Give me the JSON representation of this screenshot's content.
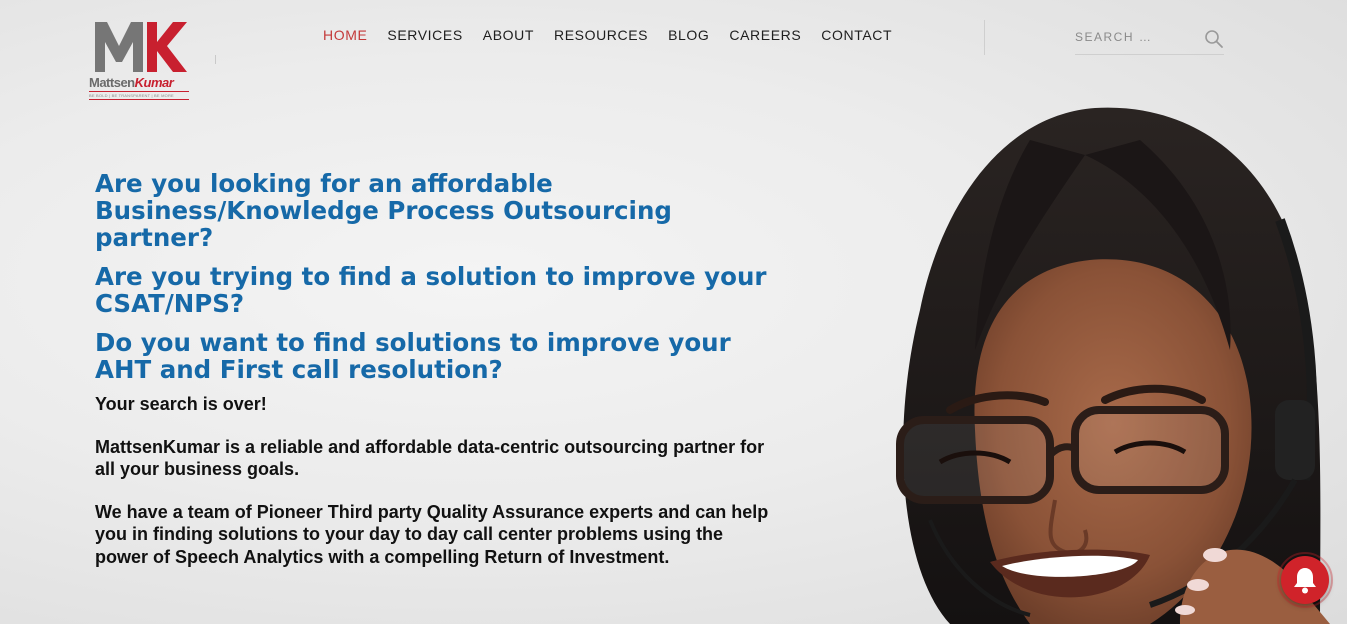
{
  "logo": {
    "monogram": "MK",
    "brand_part1": "Mattsen",
    "brand_part2": "Kumar",
    "tagline": "BE BOLD | BE TRANSPARENT | BE MORE"
  },
  "nav": {
    "items": [
      {
        "label": "HOME",
        "active": true
      },
      {
        "label": "SERVICES",
        "active": false
      },
      {
        "label": "ABOUT",
        "active": false
      },
      {
        "label": "RESOURCES",
        "active": false
      },
      {
        "label": "BLOG",
        "active": false
      },
      {
        "label": "CAREERS",
        "active": false
      },
      {
        "label": "CONTACT",
        "active": false
      }
    ]
  },
  "search": {
    "placeholder": "SEARCH …",
    "icon": "search-icon"
  },
  "hero": {
    "heading1": "Are you looking for an affordable Business/Knowledge Process Outsourcing partner?",
    "heading2": "Are you trying to find a solution to improve your CSAT/NPS?",
    "heading3": "Do you want to find solutions to improve your AHT and First call resolution?",
    "para1": "Your search is over!",
    "para2": "MattsenKumar is a reliable and affordable data-centric outsourcing partner for all your business goals.",
    "para3": "We have a team of Pioneer Third party Quality Assurance experts and can help you in finding solutions to your day to day call center problems using the power of Speech Analytics with a compelling Return of Investment."
  },
  "notification": {
    "icon": "bell-icon"
  },
  "colors": {
    "accent_red": "#c43a3a",
    "heading_blue": "#1669a8",
    "logo_gray": "#6b6b6b",
    "logo_red": "#c8202f",
    "bell_red": "#d0232a"
  }
}
